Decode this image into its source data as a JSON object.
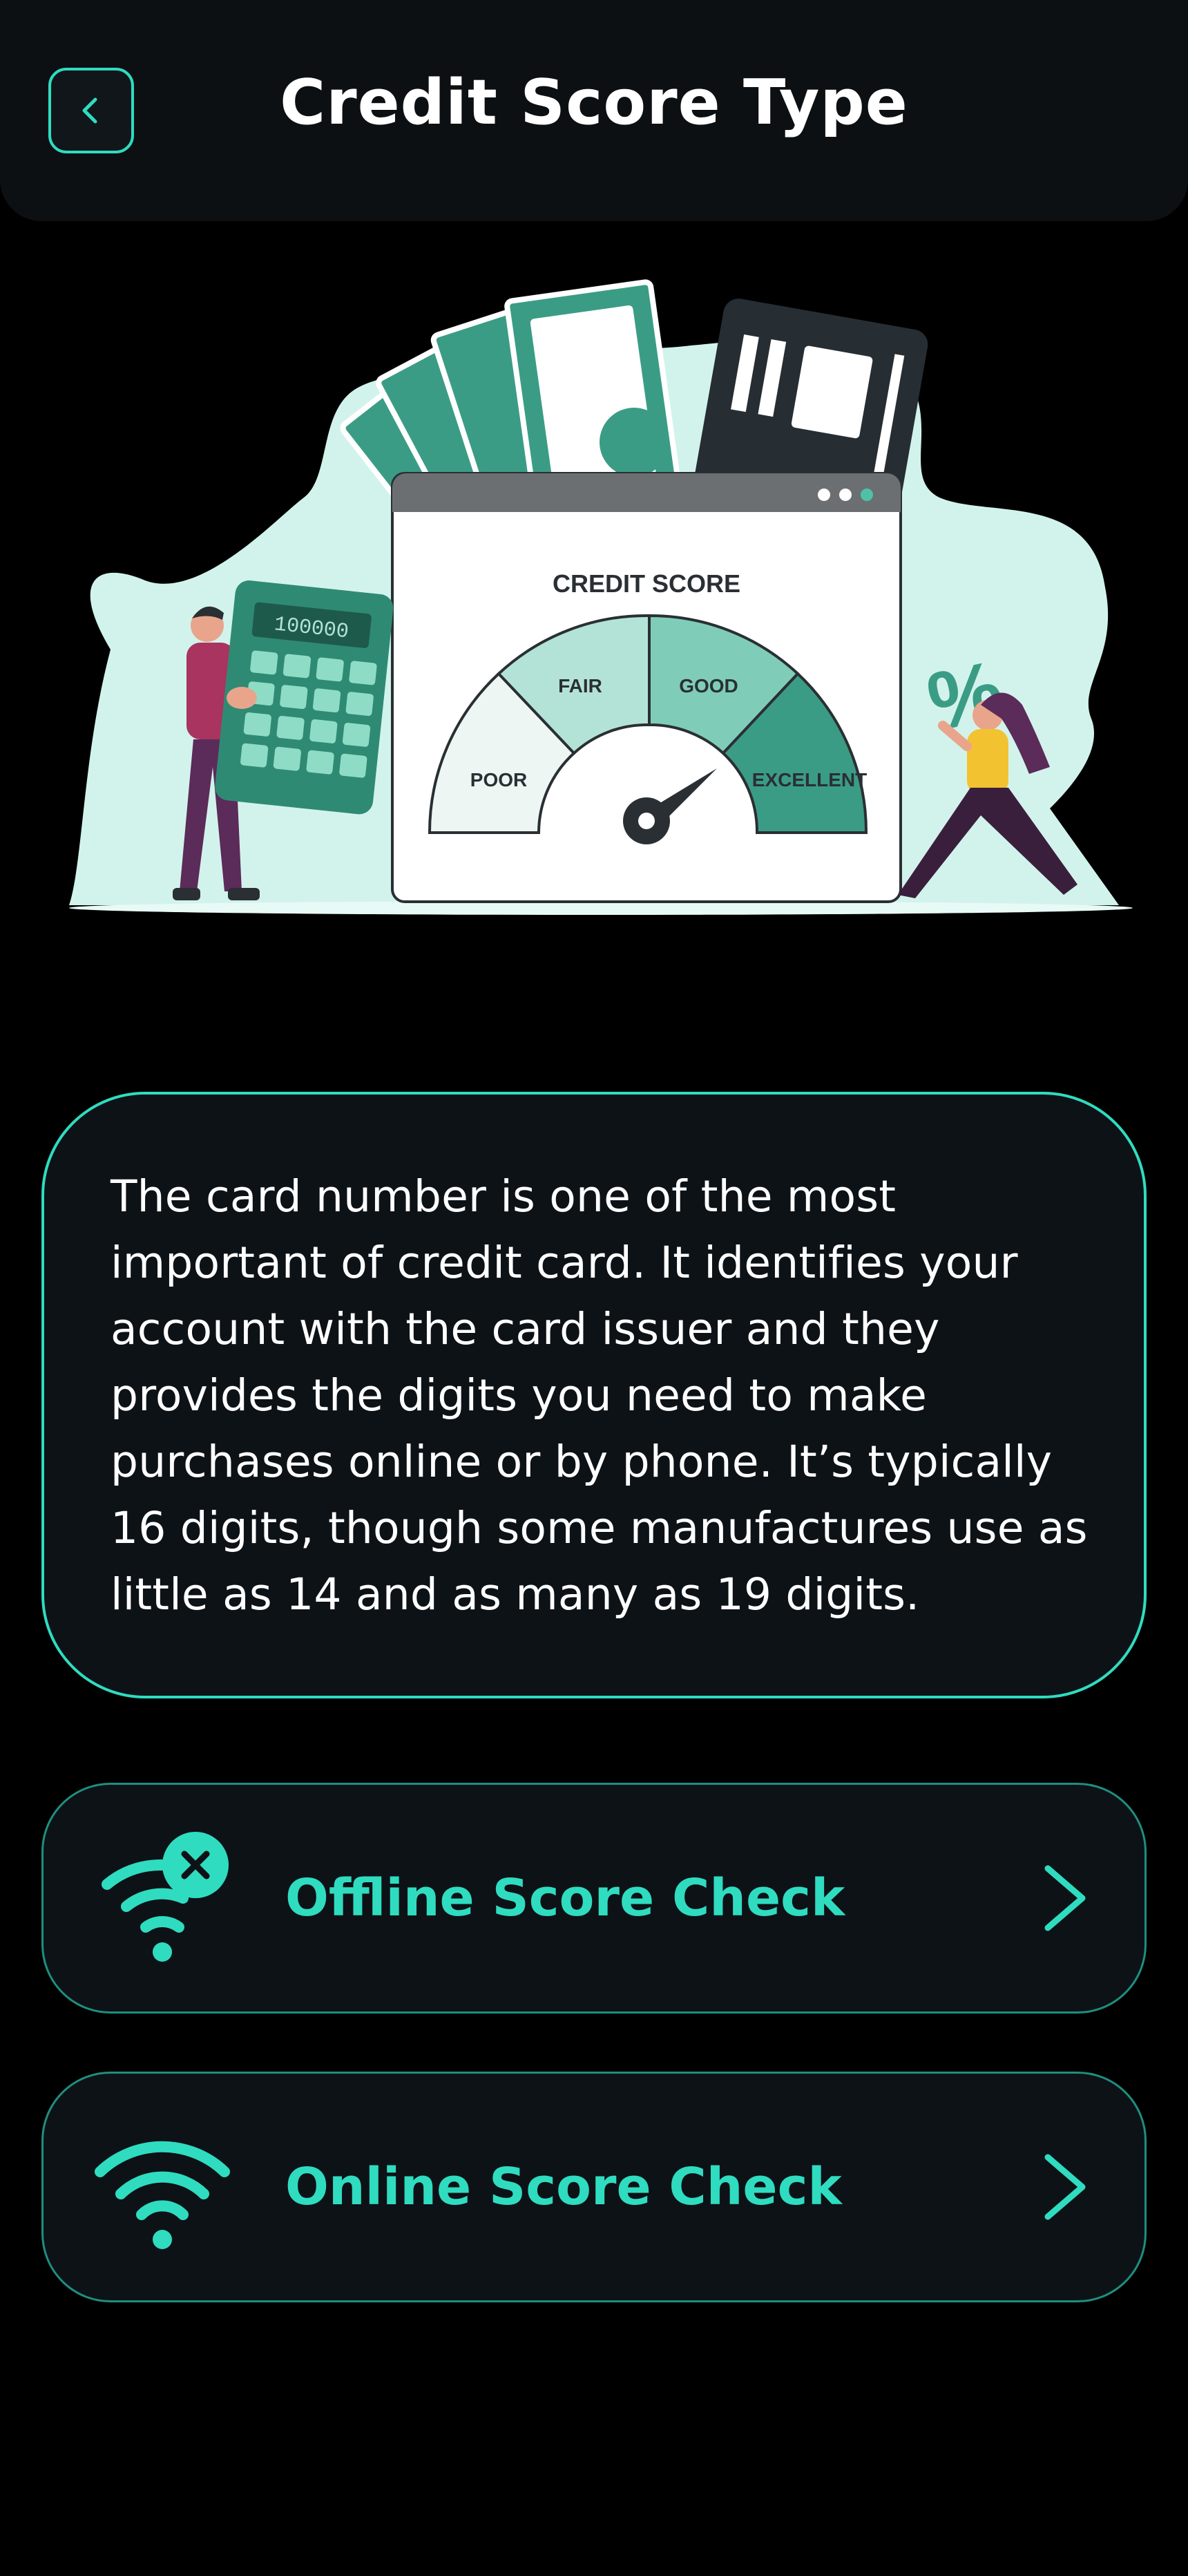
{
  "header": {
    "title": "Credit Score Type"
  },
  "illustration": {
    "gauge_title": "CREDIT SCORE",
    "segments": [
      "POOR",
      "FAIR",
      "GOOD",
      "EXCELLENT"
    ],
    "calculator_display": "100000",
    "percent_symbol": "%"
  },
  "info": {
    "text": "The card number is one of the most important of credit card. It identifies your account with the card issuer and they provides the digits you need to make purchases online or by phone. It’s typically 16 digits, though some manufactures use as little as 14 and as many as 19 digits."
  },
  "options": [
    {
      "label": "Offline Score Check",
      "icon": "wifi-off-icon"
    },
    {
      "label": "Online Score Check",
      "icon": "wifi-icon"
    }
  ],
  "colors": {
    "accent": "#2fdcc0",
    "background": "#000000",
    "card": "#0d1217"
  }
}
